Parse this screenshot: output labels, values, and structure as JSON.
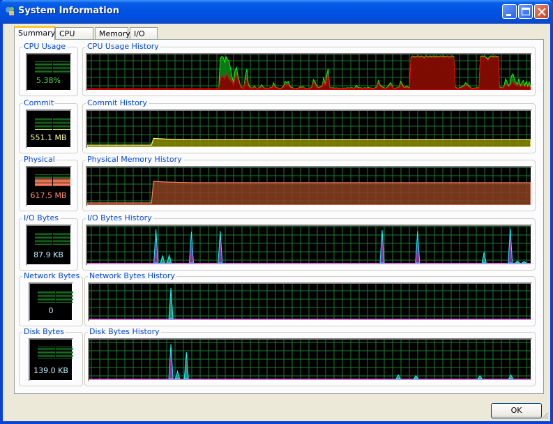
{
  "window": {
    "title": "System Information",
    "icon": "system-info-icon",
    "controls": [
      "minimize-icon",
      "maximize-icon",
      "close-icon"
    ]
  },
  "tabs": [
    {
      "label": "Summary",
      "active": true
    },
    {
      "label": "CPU",
      "active": false
    },
    {
      "label": "Memory",
      "active": false
    },
    {
      "label": "I/O",
      "active": false
    }
  ],
  "colors": {
    "grid": "#1f7a2e",
    "cpu_total": "#00ff00",
    "cpu_kernel": "#ff0000",
    "commit": "#ffff80",
    "physical": "#ff8060",
    "io_other": "#ffff00",
    "io_read": "#ff00ff",
    "io_write": "#00ffff",
    "meter_value_cpu": "#4ee04e",
    "meter_value_commit": "#ffff9c",
    "meter_value_physical": "#ff9070",
    "meter_value_io": "#bff2ff"
  },
  "panels": [
    {
      "meter_label": "CPU Usage",
      "meter_value": "5.38%",
      "history_label": "CPU Usage History"
    },
    {
      "meter_label": "Commit",
      "meter_value": "551.1 MB",
      "history_label": "Commit History"
    },
    {
      "meter_label": "Physical",
      "meter_value": "617.5 MB",
      "history_label": "Physical Memory History"
    },
    {
      "meter_label": "I/O Bytes",
      "meter_value": "87.9  KB",
      "history_label": "I/O Bytes History"
    },
    {
      "meter_label": "Network Bytes",
      "meter_value": "0",
      "history_label": "Network Bytes History"
    },
    {
      "meter_label": "Disk Bytes",
      "meter_value": "139.0  KB",
      "history_label": "Disk Bytes History"
    }
  ],
  "buttons": {
    "ok": "OK"
  },
  "chart_data": [
    {
      "type": "area",
      "title": "CPU Usage History",
      "ylim": [
        0,
        100
      ],
      "series": [
        {
          "name": "total",
          "values": [
            0,
            0,
            0,
            0,
            0,
            0,
            0,
            0,
            0,
            0,
            0,
            0,
            0,
            0,
            0,
            0,
            0,
            0,
            0,
            0,
            0,
            0,
            0,
            0,
            0,
            0,
            0,
            0,
            0,
            0,
            0,
            0,
            0,
            0,
            0,
            0,
            0,
            0,
            0,
            0,
            0,
            0,
            0,
            0,
            0,
            0,
            0,
            0,
            0,
            0,
            0,
            0,
            0,
            0,
            0,
            0,
            0,
            0,
            0,
            0,
            0,
            0,
            0,
            0,
            0,
            0,
            0,
            0,
            0,
            0,
            0,
            0,
            0,
            0,
            0,
            0,
            0,
            0,
            0,
            0,
            0,
            0,
            0,
            0,
            0,
            0,
            0,
            0,
            0,
            0,
            92,
            98,
            96,
            80,
            97,
            88,
            85,
            60,
            35,
            20,
            55,
            65,
            40,
            20,
            5,
            2,
            1,
            40,
            60,
            15,
            5,
            2,
            2,
            8,
            3,
            0,
            2,
            5,
            12,
            5,
            2,
            1,
            0,
            1,
            4,
            2,
            18,
            8,
            3,
            2,
            1,
            1,
            3,
            10,
            22,
            18,
            22,
            10,
            4,
            2,
            1,
            0,
            1,
            2,
            5,
            4,
            6,
            2,
            1,
            0,
            1,
            2,
            5,
            28,
            22,
            10,
            3,
            4,
            6,
            8,
            35,
            12,
            42,
            60,
            5,
            2,
            3,
            1,
            2,
            2,
            1,
            2,
            0,
            1,
            2,
            1,
            3,
            2,
            2,
            3,
            1,
            2,
            10,
            4,
            2,
            3,
            1,
            2,
            3,
            1,
            4,
            2,
            2,
            1,
            1,
            3,
            5,
            25,
            12,
            8,
            4,
            2,
            1,
            5,
            10,
            18,
            12,
            2,
            1,
            2,
            3,
            6,
            22,
            15,
            5,
            3,
            8,
            4,
            2,
            95,
            100,
            98,
            97,
            99,
            100,
            97,
            100,
            98,
            95,
            100,
            99,
            97,
            100,
            98,
            100,
            96,
            100,
            99,
            97,
            100,
            98,
            100,
            97,
            99,
            100,
            96,
            98,
            100,
            99,
            5,
            2,
            1,
            3,
            4,
            8,
            10,
            18,
            14,
            10,
            5,
            1,
            1,
            2,
            1,
            3,
            2,
            98,
            100,
            99,
            100,
            95,
            90,
            96,
            100,
            99,
            98,
            100,
            98,
            99,
            5,
            3,
            2,
            8,
            30,
            20,
            10,
            14,
            38,
            45,
            28,
            20,
            14,
            28,
            10,
            18,
            25,
            10,
            22,
            8,
            20,
            5
          ]
        },
        {
          "name": "kernel",
          "values": [
            0,
            0,
            0,
            0,
            0,
            0,
            0,
            0,
            0,
            0,
            0,
            0,
            0,
            0,
            0,
            0,
            0,
            0,
            0,
            0,
            0,
            0,
            0,
            0,
            0,
            0,
            0,
            0,
            0,
            0,
            0,
            0,
            0,
            0,
            0,
            0,
            0,
            0,
            0,
            0,
            0,
            0,
            0,
            0,
            0,
            0,
            0,
            0,
            0,
            0,
            0,
            0,
            0,
            0,
            0,
            0,
            0,
            0,
            0,
            0,
            0,
            0,
            0,
            0,
            0,
            0,
            0,
            0,
            0,
            0,
            0,
            0,
            0,
            0,
            0,
            0,
            0,
            0,
            0,
            0,
            0,
            0,
            0,
            0,
            0,
            0,
            0,
            0,
            0,
            0,
            25,
            40,
            35,
            30,
            45,
            38,
            30,
            25,
            20,
            10,
            35,
            40,
            28,
            15,
            3,
            1,
            0,
            25,
            30,
            8,
            3,
            1,
            1,
            5,
            2,
            0,
            1,
            3,
            8,
            3,
            1,
            0,
            0,
            0,
            3,
            1,
            12,
            5,
            2,
            1,
            0,
            0,
            2,
            6,
            15,
            10,
            14,
            6,
            2,
            1,
            0,
            0,
            0,
            1,
            3,
            2,
            4,
            1,
            0,
            0,
            0,
            1,
            3,
            20,
            15,
            6,
            2,
            2,
            4,
            5,
            25,
            8,
            30,
            45,
            3,
            1,
            2,
            0,
            1,
            1,
            0,
            1,
            0,
            0,
            1,
            0,
            2,
            1,
            1,
            2,
            0,
            1,
            5,
            2,
            1,
            2,
            0,
            1,
            2,
            0,
            2,
            1,
            1,
            0,
            0,
            2,
            3,
            18,
            8,
            5,
            2,
            1,
            0,
            3,
            6,
            12,
            8,
            1,
            0,
            1,
            2,
            4,
            15,
            10,
            3,
            2,
            5,
            2,
            1,
            92,
            98,
            95,
            95,
            97,
            98,
            95,
            97,
            96,
            92,
            98,
            96,
            95,
            97,
            95,
            98,
            94,
            97,
            96,
            95,
            98,
            96,
            97,
            95,
            97,
            98,
            94,
            96,
            98,
            96,
            3,
            1,
            0,
            2,
            2,
            5,
            6,
            12,
            9,
            6,
            3,
            0,
            0,
            1,
            0,
            2,
            1,
            95,
            97,
            96,
            97,
            92,
            85,
            93,
            97,
            96,
            95,
            97,
            95,
            96,
            3,
            2,
            1,
            5,
            15,
            10,
            5,
            8,
            18,
            22,
            14,
            10,
            8,
            14,
            5,
            9,
            12,
            5,
            10,
            4,
            10,
            3
          ]
        }
      ]
    },
    {
      "type": "area",
      "title": "Commit History",
      "ylim": [
        0,
        100
      ],
      "series": [
        {
          "name": "commit",
          "values_flat_before": 2,
          "step_index": 0.145,
          "values_flat_after": 18
        }
      ]
    },
    {
      "type": "area",
      "title": "Physical Memory History",
      "ylim": [
        0,
        100
      ],
      "series": [
        {
          "name": "physical",
          "values_flat_before": 2,
          "step_index": 0.145,
          "values_flat_after": 60
        }
      ]
    },
    {
      "type": "area",
      "title": "I/O Bytes History",
      "ylim": [
        0,
        100
      ],
      "spikes": [
        [
          0.155,
          95,
          "m"
        ],
        [
          0.17,
          20,
          "c"
        ],
        [
          0.185,
          22,
          "c"
        ],
        [
          0.235,
          88,
          "m"
        ],
        [
          0.3,
          90,
          "m"
        ],
        [
          0.665,
          92,
          "m"
        ],
        [
          0.745,
          90,
          "m"
        ],
        [
          0.895,
          30,
          "c"
        ],
        [
          0.954,
          96,
          "m"
        ],
        [
          0.97,
          5,
          "c"
        ],
        [
          0.985,
          4,
          "c"
        ]
      ]
    },
    {
      "type": "area",
      "title": "Network Bytes History",
      "ylim": [
        0,
        100
      ],
      "spikes": [
        [
          0.185,
          92,
          "c"
        ]
      ]
    },
    {
      "type": "area",
      "title": "Disk Bytes History",
      "ylim": [
        0,
        100
      ],
      "spikes": [
        [
          0.185,
          92,
          "m"
        ],
        [
          0.2,
          20,
          "c"
        ],
        [
          0.22,
          70,
          "c"
        ],
        [
          0.7,
          10,
          "c"
        ],
        [
          0.74,
          8,
          "c"
        ],
        [
          0.885,
          8,
          "c"
        ],
        [
          0.955,
          10,
          "c"
        ]
      ]
    }
  ]
}
